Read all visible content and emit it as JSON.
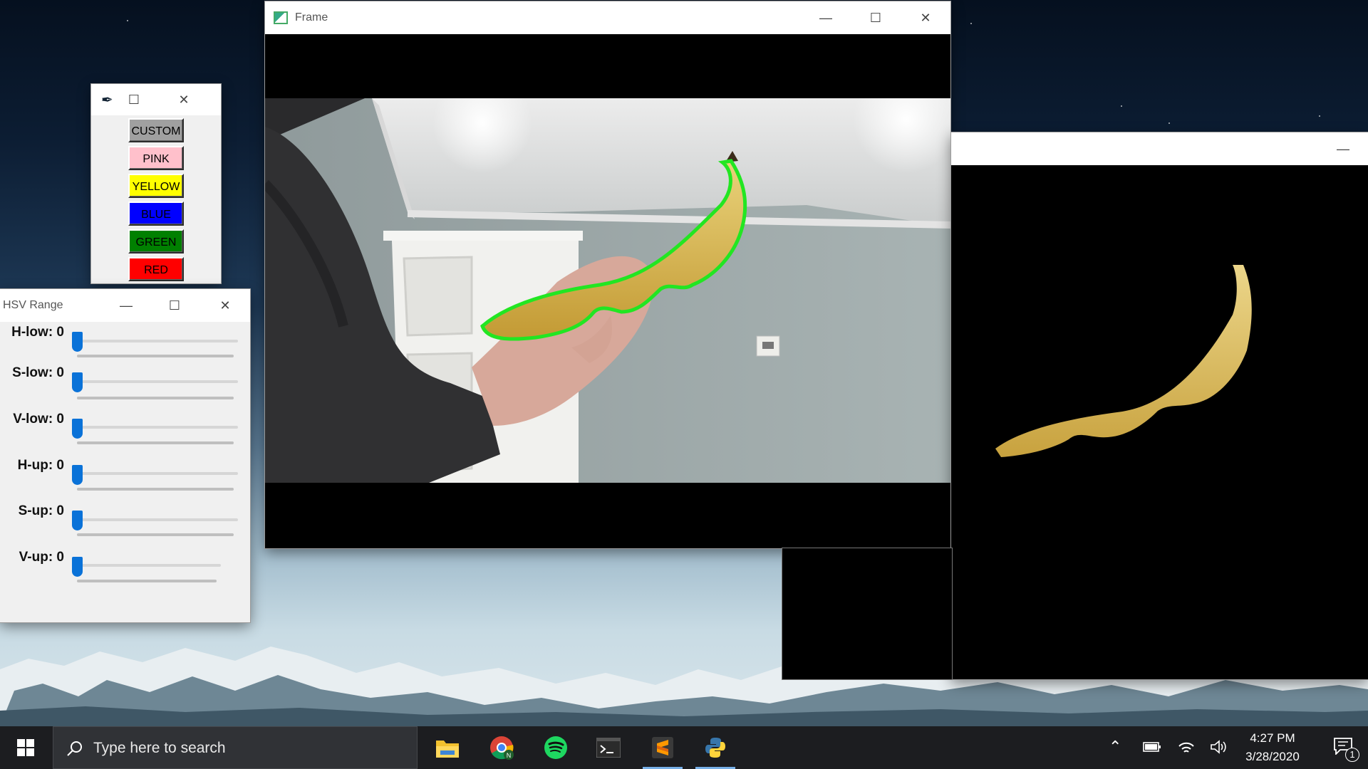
{
  "frame_window": {
    "title": "Frame"
  },
  "mask_window": {
    "title": ""
  },
  "color_window": {
    "buttons": [
      {
        "label": "CUSTOM",
        "color": "#a0a0a0"
      },
      {
        "label": "PINK",
        "color": "#ffc0cb"
      },
      {
        "label": "YELLOW",
        "color": "#ffff00"
      },
      {
        "label": "BLUE",
        "color": "#0000ff"
      },
      {
        "label": "GREEN",
        "color": "#008000"
      },
      {
        "label": "RED",
        "color": "#ff0000"
      }
    ]
  },
  "hsv_window": {
    "title": "HSV Range",
    "sliders": [
      {
        "label": "H-low: 0",
        "value": 0
      },
      {
        "label": "S-low: 0",
        "value": 0
      },
      {
        "label": "V-low: 0",
        "value": 0
      },
      {
        "label": "H-up: 0",
        "value": 0
      },
      {
        "label": "S-up: 0",
        "value": 0
      },
      {
        "label": "V-up: 0",
        "value": 0
      }
    ]
  },
  "taskbar": {
    "search_placeholder": "Type here to search",
    "apps": [
      "file-explorer-icon",
      "chrome-icon",
      "spotify-icon",
      "terminal-icon",
      "sublime-text-icon",
      "python-icon"
    ],
    "time": "4:27 PM",
    "date": "3/28/2020",
    "notification_count": "1"
  },
  "colors": {
    "contour": "#22e622",
    "accent": "#0a72d8"
  }
}
